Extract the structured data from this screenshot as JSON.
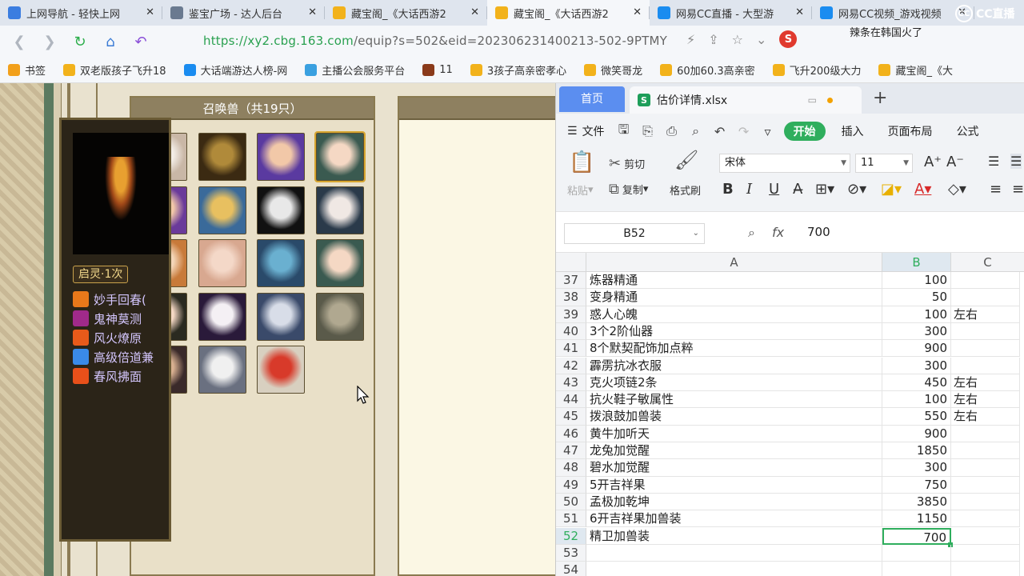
{
  "browser": {
    "tabs": [
      {
        "title": "上网导航 - 轻快上网",
        "icon": "sogou-icon",
        "color": "#3b7de0",
        "active": false
      },
      {
        "title": "鉴宝广场 - 达人后台",
        "icon": "globe-icon",
        "color": "#6a7a90",
        "active": false
      },
      {
        "title": "藏宝阁_《大话西游2",
        "icon": "chick-icon",
        "color": "#f2b21b",
        "active": false
      },
      {
        "title": "藏宝阁_《大话西游2",
        "icon": "chick-icon",
        "color": "#f2b21b",
        "active": true
      },
      {
        "title": "网易CC直播 - 大型游",
        "icon": "cc-icon",
        "color": "#1a8cf0",
        "active": false
      },
      {
        "title": "网易CC视频_游戏视频",
        "icon": "cc-icon",
        "color": "#1a8cf0",
        "active": false
      }
    ],
    "close_glyph": "✕",
    "logo_text": "CC直播",
    "url_prefix": "https://",
    "url_host": "xy2.cbg.163.com",
    "url_rest": "/equip?s=502&eid=202306231400213-502-9PTMY",
    "hot_badge": "S",
    "hot_text": "辣条在韩国火了",
    "bookmarks": [
      {
        "label": "书签",
        "color": "#f2a01b"
      },
      {
        "label": "双老版孩子飞升18",
        "color": "#f2b21b"
      },
      {
        "label": "大话端游达人榜-网",
        "color": "#1a8cf0"
      },
      {
        "label": "主播公会服务平台",
        "color": "#3aa0e0"
      },
      {
        "label": "11",
        "color": "#8a3a1a"
      },
      {
        "label": "3孩子高亲密孝心",
        "color": "#f2b21b"
      },
      {
        "label": "微笑哥龙",
        "color": "#f2b21b"
      },
      {
        "label": "60加60.3高亲密",
        "color": "#f2b21b"
      },
      {
        "label": "飞升200级大力",
        "color": "#f2b21b"
      },
      {
        "label": "藏宝阁_《大",
        "color": "#f2b21b"
      }
    ]
  },
  "game": {
    "pets_title": "召唤兽（共19只）",
    "pets": [
      {
        "name": "white-bear-pet",
        "bg": "#c9b7a6",
        "face": "#f3ede6"
      },
      {
        "name": "black-ox-pet",
        "bg": "#3b2a12",
        "face": "#b08a3a"
      },
      {
        "name": "girl-pet-1",
        "bg": "#5a3aa0",
        "face": "#f2c8a8"
      },
      {
        "name": "lady-pet-1",
        "bg": "#3a5a50",
        "face": "#f5d8c4"
      },
      {
        "name": "girl-pet-2",
        "bg": "#6a3a9a",
        "face": "#f2c8a8"
      },
      {
        "name": "golden-beast-pet",
        "bg": "#3a6a9a",
        "face": "#e8c060"
      },
      {
        "name": "white-bird-pet",
        "bg": "#111111",
        "face": "#e8e8e8"
      },
      {
        "name": "pale-lady-pet",
        "bg": "#2a3a4a",
        "face": "#f0e8e4"
      },
      {
        "name": "lion-cub-pet",
        "bg": "#c87a3a",
        "face": "#f4d6b8"
      },
      {
        "name": "doll-pet",
        "bg": "#d8a890",
        "face": "#f4d8c8"
      },
      {
        "name": "frog-pet",
        "bg": "#2a4a6a",
        "face": "#6ab0d0"
      },
      {
        "name": "lady-pet-2",
        "bg": "#3a5a50",
        "face": "#f5d8c4"
      },
      {
        "name": "lady-pet-3",
        "bg": "#2a2a20",
        "face": "#f5d8c4"
      },
      {
        "name": "white-fox-pet",
        "bg": "#2a1a3a",
        "face": "#f4f0f4"
      },
      {
        "name": "silver-warrior-pet",
        "bg": "#3a4a6a",
        "face": "#d8dde8"
      },
      {
        "name": "mirror-pet",
        "bg": "#5a5a4a",
        "face": "#b0a890"
      },
      {
        "name": "dark-girl-pet",
        "bg": "#3a2a2a",
        "face": "#d8b090"
      },
      {
        "name": "white-tiger-pet",
        "bg": "#6a7080",
        "face": "#f0f0f0"
      },
      {
        "name": "red-lion-pet",
        "bg": "#d8d0c0",
        "face": "#d83a2a"
      }
    ],
    "awaken_label": "启灵·1次",
    "skills": [
      {
        "label": "妙手回春(",
        "color": "#e8781a"
      },
      {
        "label": "鬼神莫测",
        "color": "#a02a8a"
      },
      {
        "label": "风火燎原",
        "color": "#e85a1a"
      },
      {
        "label": "高级倍道兼",
        "color": "#3a8ae8"
      },
      {
        "label": "春风拂面",
        "color": "#e8501a"
      }
    ]
  },
  "wps": {
    "home_tab": "首页",
    "file_icon": "S",
    "file_tab": "估价详情.xlsx",
    "menu": {
      "file": "文件",
      "start": "开始",
      "tabs": [
        "插入",
        "页面布局",
        "公式"
      ]
    },
    "ribbon": {
      "paste": "粘贴",
      "cut": "剪切",
      "copy": "复制",
      "format_painter": "格式刷",
      "font_name": "宋体",
      "font_size": "11"
    },
    "name_box": "B52",
    "formula_value": "700",
    "columns": [
      "A",
      "B",
      "C"
    ],
    "rows": [
      {
        "n": "37",
        "a": "炼器精通",
        "b": "100",
        "c": ""
      },
      {
        "n": "38",
        "a": "变身精通",
        "b": "50",
        "c": ""
      },
      {
        "n": "39",
        "a": "惑人心魄",
        "b": "100",
        "c": "左右"
      },
      {
        "n": "40",
        "a": "3个2阶仙器",
        "b": "300",
        "c": ""
      },
      {
        "n": "41",
        "a": "8个默契配饰加点粹",
        "b": "900",
        "c": ""
      },
      {
        "n": "42",
        "a": "霹雳抗冰衣服",
        "b": "300",
        "c": ""
      },
      {
        "n": "43",
        "a": "克火项链2条",
        "b": "450",
        "c": "左右"
      },
      {
        "n": "44",
        "a": "抗火鞋子敏属性",
        "b": "100",
        "c": "左右"
      },
      {
        "n": "45",
        "a": "拨浪鼓加兽装",
        "b": "550",
        "c": "左右"
      },
      {
        "n": "46",
        "a": "黄牛加听天",
        "b": "900",
        "c": ""
      },
      {
        "n": "47",
        "a": "龙兔加觉醒",
        "b": "1850",
        "c": ""
      },
      {
        "n": "48",
        "a": "碧水加觉醒",
        "b": "300",
        "c": ""
      },
      {
        "n": "49",
        "a": "5开吉祥果",
        "b": "750",
        "c": ""
      },
      {
        "n": "50",
        "a": "孟极加乾坤",
        "b": "3850",
        "c": ""
      },
      {
        "n": "51",
        "a": "6开吉祥果加兽装",
        "b": "1150",
        "c": ""
      },
      {
        "n": "52",
        "a": "精卫加兽装",
        "b": "700",
        "c": "",
        "selected": true
      },
      {
        "n": "53",
        "a": "",
        "b": "",
        "c": ""
      },
      {
        "n": "54",
        "a": "",
        "b": "",
        "c": ""
      }
    ]
  }
}
